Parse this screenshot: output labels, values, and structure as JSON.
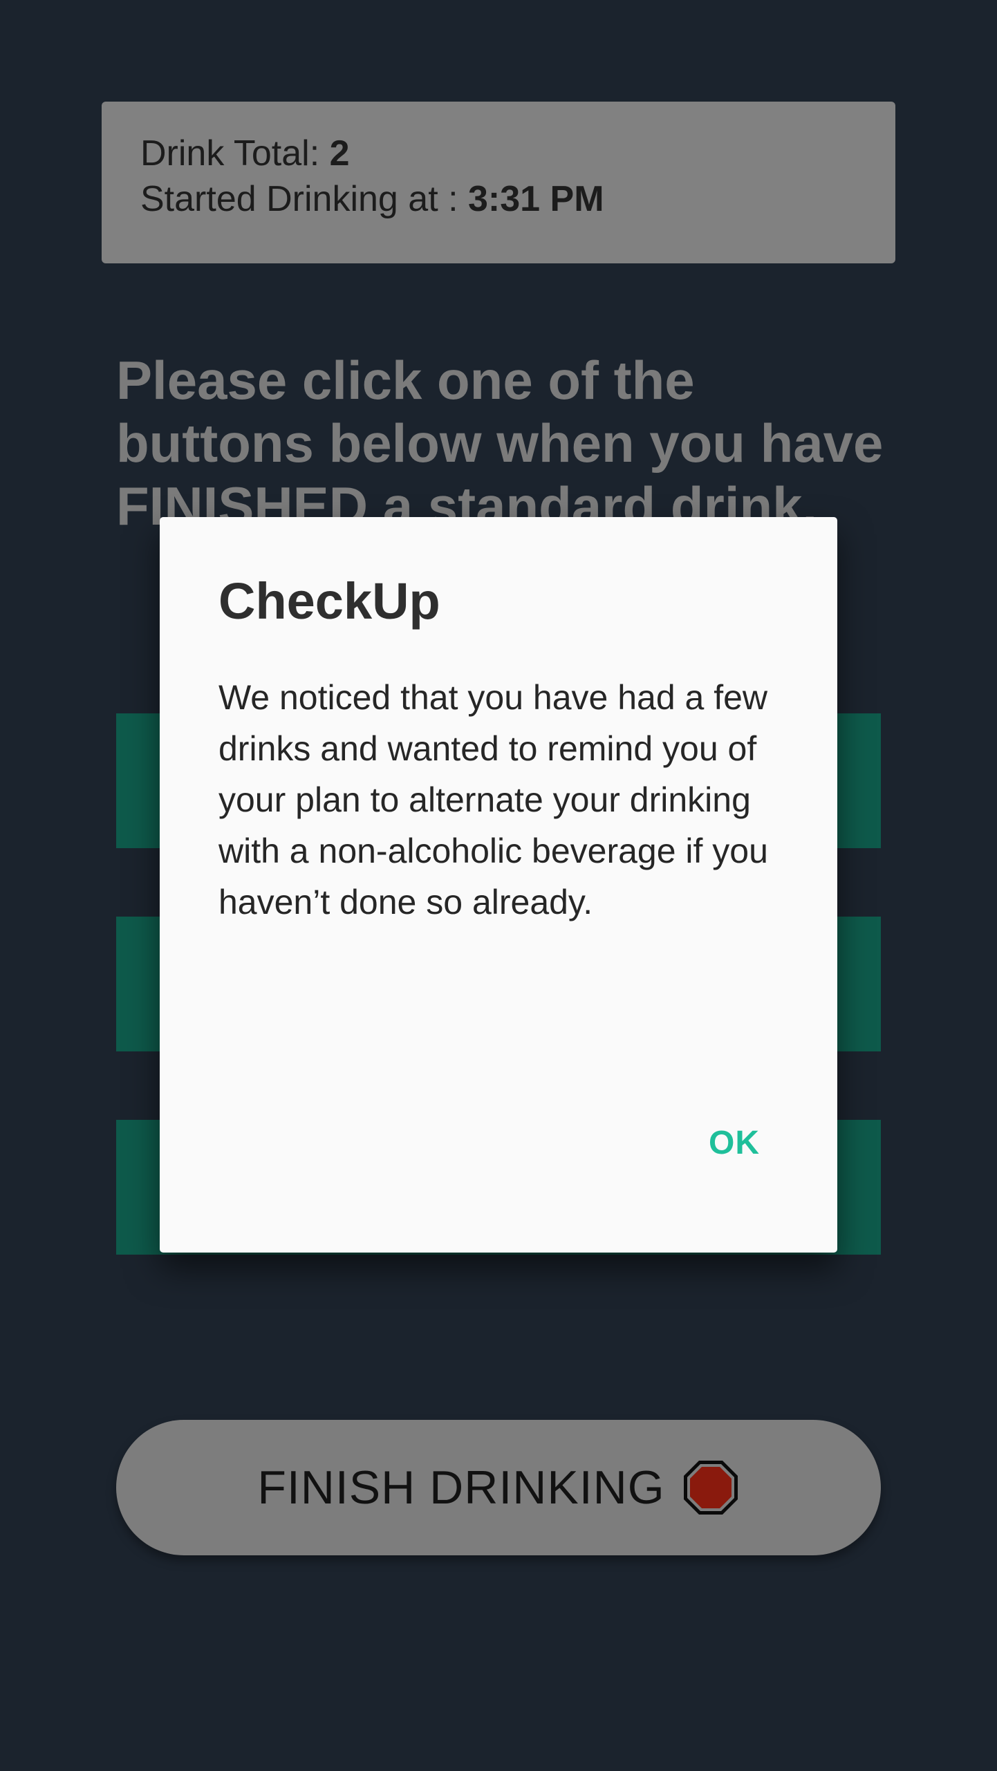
{
  "status": {
    "drink_total_label": "Drink Total: ",
    "drink_total_value": "2",
    "started_label": "Started Drinking at : ",
    "started_value": "3:31 PM"
  },
  "instruction": "Please click one of the buttons below when you have FINISHED a standard drink.",
  "finish_button": {
    "label": "FINISH DRINKING",
    "icon": "stop-sign-icon"
  },
  "dialog": {
    "title": "CheckUp",
    "message": "We noticed that you have had a few drinks and wanted to remind you of your plan to alternate your drinking with a non-alcoholic beverage if you haven’t done so already.",
    "ok_label": "OK"
  },
  "colors": {
    "background": "#1b232d",
    "card": "#818181",
    "drink_button": "#0e5a4b",
    "accent": "#1fbf9a",
    "stop": "#8a1a0d"
  }
}
